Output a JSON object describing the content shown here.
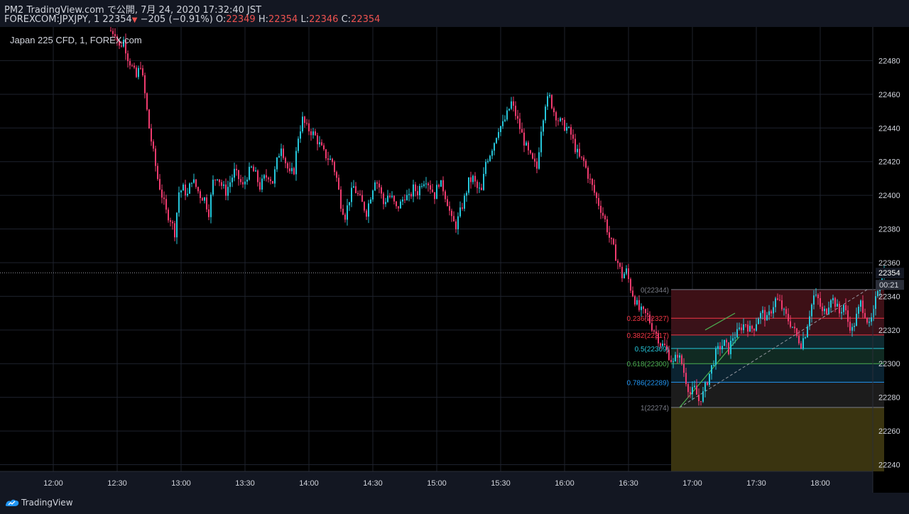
{
  "header": {
    "line1": "PM2 TradingView.com で公開, 7月 24, 2020 17:32:40 JST",
    "symbol": "FOREXCOM:JPXJPY, 1",
    "last": "22354",
    "change": "−205 (−0.91%)",
    "o_label": "O:",
    "o_val": "22349",
    "h_label": "H:",
    "h_val": "22354",
    "l_label": "L:",
    "l_val": "22346",
    "c_label": "C:",
    "c_val": "22354"
  },
  "footer": {
    "brand": "TradingView"
  },
  "colors": {
    "background": "#000000",
    "up": "#26c6da",
    "down": "#ef3b6e",
    "grid": "#1e222d",
    "axis_text": "#d1d4dc",
    "trend": "#4caf50"
  },
  "chart_data": {
    "type": "candlestick",
    "title": "Japan 225 CFD, 1, FOREX.com",
    "xlabel": "",
    "ylabel": "",
    "ylim": [
      22236,
      22500
    ],
    "y_ticks": [
      "22480",
      "22460",
      "22440",
      "22420",
      "22400",
      "22380",
      "22360",
      "22340",
      "22320",
      "22300",
      "22280",
      "22260",
      "22240"
    ],
    "x_ticks": [
      "12:00",
      "12:30",
      "13:00",
      "13:30",
      "14:00",
      "14:30",
      "15:00",
      "15:30",
      "16:00",
      "16:30",
      "17:00",
      "17:30",
      "18:00"
    ],
    "x_range_min": [
      690,
      1110
    ],
    "last_price": "22354",
    "countdown": "00:21",
    "price_path": [
      [
        747,
        22498
      ],
      [
        750,
        22497
      ],
      [
        752,
        22488
      ],
      [
        754,
        22492
      ],
      [
        756,
        22482
      ],
      [
        758,
        22476
      ],
      [
        760,
        22470
      ],
      [
        762,
        22478
      ],
      [
        764,
        22460
      ],
      [
        766,
        22440
      ],
      [
        768,
        22425
      ],
      [
        770,
        22410
      ],
      [
        772,
        22400
      ],
      [
        774,
        22390
      ],
      [
        776,
        22386
      ],
      [
        778,
        22378
      ],
      [
        780,
        22402
      ],
      [
        782,
        22404
      ],
      [
        784,
        22400
      ],
      [
        786,
        22410
      ],
      [
        788,
        22405
      ],
      [
        790,
        22400
      ],
      [
        792,
        22398
      ],
      [
        794,
        22390
      ],
      [
        796,
        22408
      ],
      [
        798,
        22412
      ],
      [
        800,
        22406
      ],
      [
        802,
        22402
      ],
      [
        804,
        22408
      ],
      [
        806,
        22414
      ],
      [
        808,
        22410
      ],
      [
        810,
        22405
      ],
      [
        812,
        22412
      ],
      [
        814,
        22416
      ],
      [
        816,
        22412
      ],
      [
        818,
        22405
      ],
      [
        820,
        22410
      ],
      [
        822,
        22412
      ],
      [
        824,
        22408
      ],
      [
        826,
        22420
      ],
      [
        828,
        22430
      ],
      [
        830,
        22420
      ],
      [
        832,
        22412
      ],
      [
        834,
        22415
      ],
      [
        836,
        22435
      ],
      [
        838,
        22445
      ],
      [
        840,
        22440
      ],
      [
        842,
        22438
      ],
      [
        844,
        22435
      ],
      [
        846,
        22430
      ],
      [
        848,
        22425
      ],
      [
        850,
        22422
      ],
      [
        852,
        22420
      ],
      [
        854,
        22410
      ],
      [
        856,
        22395
      ],
      [
        858,
        22388
      ],
      [
        860,
        22398
      ],
      [
        862,
        22405
      ],
      [
        864,
        22400
      ],
      [
        866,
        22395
      ],
      [
        868,
        22390
      ],
      [
        870,
        22400
      ],
      [
        872,
        22410
      ],
      [
        874,
        22405
      ],
      [
        876,
        22395
      ],
      [
        878,
        22400
      ],
      [
        880,
        22398
      ],
      [
        882,
        22392
      ],
      [
        884,
        22395
      ],
      [
        886,
        22400
      ],
      [
        888,
        22398
      ],
      [
        890,
        22404
      ],
      [
        892,
        22402
      ],
      [
        894,
        22408
      ],
      [
        896,
        22410
      ],
      [
        898,
        22405
      ],
      [
        900,
        22400
      ],
      [
        902,
        22408
      ],
      [
        904,
        22404
      ],
      [
        906,
        22396
      ],
      [
        908,
        22385
      ],
      [
        910,
        22382
      ],
      [
        912,
        22390
      ],
      [
        914,
        22398
      ],
      [
        916,
        22408
      ],
      [
        918,
        22410
      ],
      [
        920,
        22404
      ],
      [
        922,
        22402
      ],
      [
        924,
        22420
      ],
      [
        926,
        22425
      ],
      [
        928,
        22432
      ],
      [
        930,
        22440
      ],
      [
        932,
        22442
      ],
      [
        934,
        22448
      ],
      [
        936,
        22455
      ],
      [
        938,
        22448
      ],
      [
        940,
        22440
      ],
      [
        942,
        22432
      ],
      [
        944,
        22425
      ],
      [
        946,
        22420
      ],
      [
        948,
        22416
      ],
      [
        950,
        22440
      ],
      [
        952,
        22455
      ],
      [
        954,
        22458
      ],
      [
        956,
        22450
      ],
      [
        958,
        22445
      ],
      [
        960,
        22442
      ],
      [
        962,
        22440
      ],
      [
        964,
        22436
      ],
      [
        966,
        22428
      ],
      [
        968,
        22422
      ],
      [
        970,
        22420
      ],
      [
        972,
        22412
      ],
      [
        974,
        22405
      ],
      [
        976,
        22398
      ],
      [
        978,
        22392
      ],
      [
        980,
        22385
      ],
      [
        982,
        22375
      ],
      [
        984,
        22368
      ],
      [
        986,
        22360
      ],
      [
        988,
        22352
      ],
      [
        990,
        22355
      ],
      [
        992,
        22345
      ],
      [
        994,
        22338
      ],
      [
        996,
        22332
      ],
      [
        998,
        22330
      ],
      [
        1000,
        22328
      ],
      [
        1002,
        22322
      ],
      [
        1004,
        22318
      ],
      [
        1006,
        22312
      ],
      [
        1008,
        22310
      ],
      [
        1010,
        22305
      ],
      [
        1012,
        22300
      ],
      [
        1014,
        22306
      ],
      [
        1016,
        22300
      ],
      [
        1018,
        22290
      ],
      [
        1020,
        22282
      ],
      [
        1022,
        22285
      ],
      [
        1024,
        22278
      ],
      [
        1026,
        22282
      ],
      [
        1028,
        22290
      ],
      [
        1030,
        22298
      ],
      [
        1032,
        22306
      ],
      [
        1034,
        22310
      ],
      [
        1036,
        22312
      ],
      [
        1038,
        22308
      ],
      [
        1040,
        22316
      ],
      [
        1042,
        22318
      ],
      [
        1044,
        22322
      ],
      [
        1046,
        22324
      ],
      [
        1048,
        22320
      ],
      [
        1050,
        22322
      ],
      [
        1052,
        22328
      ],
      [
        1054,
        22330
      ],
      [
        1056,
        22326
      ],
      [
        1058,
        22332
      ],
      [
        1060,
        22338
      ],
      [
        1062,
        22336
      ],
      [
        1064,
        22330
      ],
      [
        1066,
        22326
      ],
      [
        1068,
        22322
      ],
      [
        1070,
        22316
      ],
      [
        1072,
        22312
      ],
      [
        1074,
        22318
      ],
      [
        1076,
        22330
      ],
      [
        1078,
        22340
      ],
      [
        1080,
        22338
      ],
      [
        1082,
        22330
      ],
      [
        1084,
        22332
      ],
      [
        1086,
        22340
      ],
      [
        1088,
        22336
      ],
      [
        1090,
        22330
      ],
      [
        1092,
        22335
      ],
      [
        1094,
        22325
      ],
      [
        1096,
        22320
      ],
      [
        1098,
        22328
      ],
      [
        1100,
        22336
      ],
      [
        1102,
        22330
      ],
      [
        1104,
        22322
      ],
      [
        1106,
        22330
      ],
      [
        1108,
        22345
      ],
      [
        1110,
        22354
      ]
    ],
    "fib": {
      "levels": [
        {
          "label": "0(22344)",
          "price": 22344,
          "color": "#787b86",
          "fill": "#3d1016"
        },
        {
          "label": "0.236(22327)",
          "price": 22327,
          "color": "#f23645",
          "fill": "#3a1219"
        },
        {
          "label": "0.382(22317)",
          "price": 22317,
          "color": "#f23645",
          "fill": "#0e2a30"
        },
        {
          "label": "0.5(22309)",
          "price": 22309,
          "color": "#26c6da",
          "fill": "#102a22"
        },
        {
          "label": "0.618(22300)",
          "price": 22300,
          "color": "#4caf50",
          "fill": "#0b2331"
        },
        {
          "label": "0.786(22289)",
          "price": 22289,
          "color": "#2196f3",
          "fill": "#1c1c1c"
        },
        {
          "label": "1(22274)",
          "price": 22274,
          "color": "#787b86",
          "fill": "#3a3410"
        }
      ],
      "x_start_min": 1010,
      "x_end_min": 1110,
      "bottom_price": 22236,
      "anchor_low": [
        1014,
        22274
      ],
      "anchor_high": [
        1102,
        22344
      ],
      "trend_up": [
        [
          1014,
          22274
        ],
        [
          1042,
          22316
        ]
      ],
      "trend_upper": [
        [
          1026,
          22320
        ],
        [
          1040,
          22330
        ]
      ]
    }
  }
}
